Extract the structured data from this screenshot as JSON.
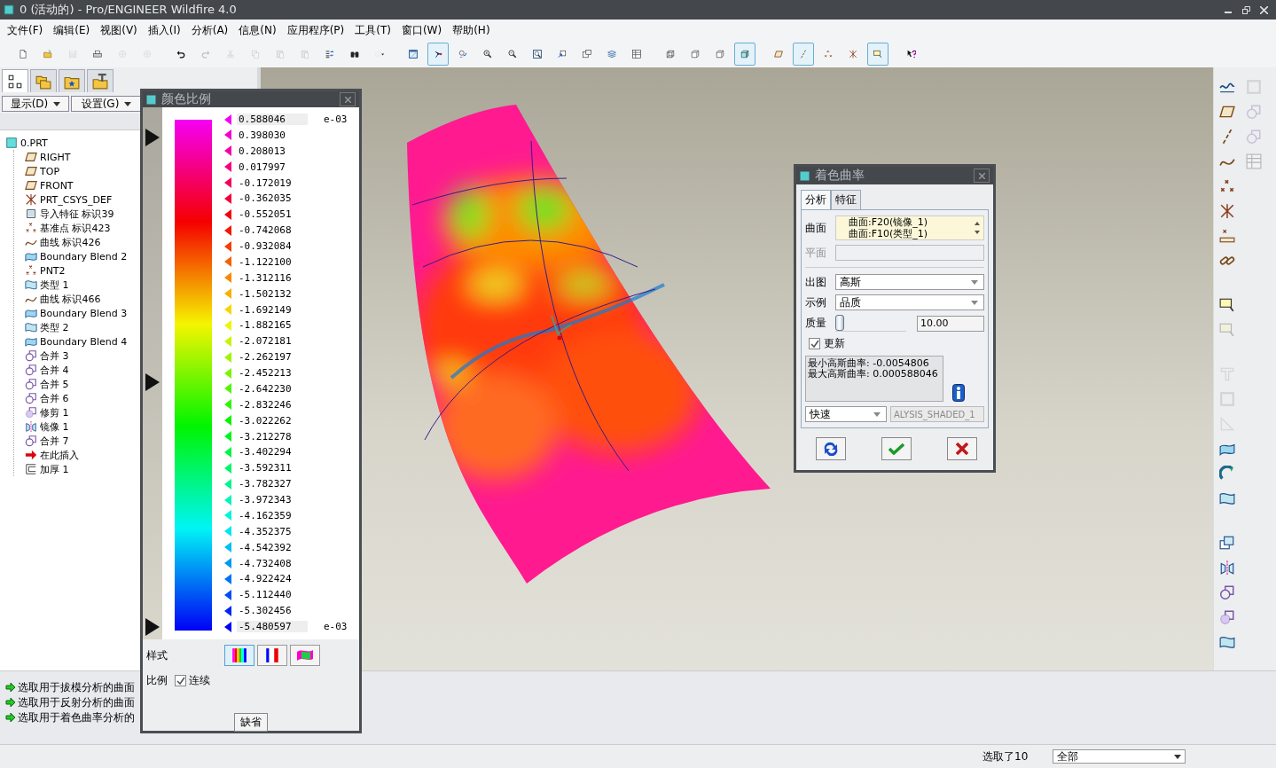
{
  "window": {
    "title": "0 (活动的) - Pro/ENGINEER Wildfire 4.0"
  },
  "menu": [
    "文件(F)",
    "编辑(E)",
    "视图(V)",
    "插入(I)",
    "分析(A)",
    "信息(N)",
    "应用程序(P)",
    "工具(T)",
    "窗口(W)",
    "帮助(H)"
  ],
  "toolbar": [
    [
      {
        "kind": "new",
        "on": false,
        "disabled": false
      },
      {
        "kind": "open",
        "on": false,
        "disabled": false
      },
      {
        "kind": "save",
        "on": false,
        "disabled": true
      },
      {
        "kind": "print",
        "on": false,
        "disabled": false
      },
      {
        "kind": "mail",
        "on": false,
        "disabled": true
      },
      {
        "kind": "mail",
        "on": false,
        "disabled": true
      }
    ],
    [
      {
        "kind": "undo",
        "on": false,
        "disabled": false
      },
      {
        "kind": "redo",
        "on": false,
        "disabled": true
      },
      {
        "kind": "cut",
        "on": false,
        "disabled": true
      },
      {
        "kind": "copy",
        "on": false,
        "disabled": true
      },
      {
        "kind": "paste",
        "on": false,
        "disabled": true
      },
      {
        "kind": "paste",
        "on": false,
        "disabled": true
      },
      {
        "kind": "regen",
        "on": false,
        "disabled": false
      },
      {
        "kind": "find",
        "on": false,
        "disabled": false
      },
      {
        "kind": "selectbox",
        "on": false,
        "disabled": true
      }
    ],
    [
      {
        "kind": "repaint",
        "on": false,
        "disabled": false
      },
      {
        "kind": "spin",
        "on": true,
        "disabled": false
      },
      {
        "kind": "orient",
        "on": false,
        "disabled": false
      },
      {
        "kind": "zoomin",
        "on": false,
        "disabled": false
      },
      {
        "kind": "zoomout",
        "on": false,
        "disabled": false
      },
      {
        "kind": "refit",
        "on": false,
        "disabled": false
      },
      {
        "kind": "reorient",
        "on": false,
        "disabled": false
      },
      {
        "kind": "views",
        "on": false,
        "disabled": false
      },
      {
        "kind": "layers",
        "on": false,
        "disabled": false
      },
      {
        "kind": "table",
        "on": false,
        "disabled": false
      }
    ],
    [
      {
        "kind": "wireframe",
        "on": false,
        "disabled": false
      },
      {
        "kind": "cube",
        "on": false,
        "disabled": false
      },
      {
        "kind": "cube",
        "on": false,
        "disabled": false
      },
      {
        "kind": "shaded",
        "on": true,
        "disabled": false
      }
    ],
    [
      {
        "kind": "plane",
        "on": false,
        "disabled": false
      },
      {
        "kind": "axis",
        "on": true,
        "disabled": false
      },
      {
        "kind": "points",
        "on": false,
        "disabled": false
      },
      {
        "kind": "csys",
        "on": false,
        "disabled": false
      },
      {
        "kind": "note",
        "on": true,
        "disabled": false
      }
    ],
    [
      {
        "kind": "help",
        "on": false,
        "disabled": false
      }
    ]
  ],
  "nav_tabs": [
    {
      "kind": "tree",
      "selected": true
    },
    {
      "kind": "folders",
      "selected": false
    },
    {
      "kind": "starfolder",
      "selected": false
    },
    {
      "kind": "toolfolder",
      "selected": false
    }
  ],
  "nav_buttons": [
    "显示(D)",
    "设置(G)"
  ],
  "tree": {
    "label": "0.PRT",
    "kind": "part",
    "children": [
      {
        "label": "RIGHT",
        "kind": "plane"
      },
      {
        "label": "TOP",
        "kind": "plane"
      },
      {
        "label": "FRONT",
        "kind": "plane"
      },
      {
        "label": "PRT_CSYS_DEF",
        "kind": "csys"
      },
      {
        "label": "导入特征 标识39",
        "kind": "import"
      },
      {
        "label": "基准点 标识423",
        "kind": "points"
      },
      {
        "label": "曲线 标识426",
        "kind": "curve"
      },
      {
        "label": "Boundary Blend 2",
        "kind": "blend"
      },
      {
        "label": "PNT2",
        "kind": "points"
      },
      {
        "label": "类型 1",
        "kind": "surface"
      },
      {
        "label": "曲线 标识466",
        "kind": "curve"
      },
      {
        "label": "Boundary Blend 3",
        "kind": "blend"
      },
      {
        "label": "类型 2",
        "kind": "surface"
      },
      {
        "label": "Boundary Blend 4",
        "kind": "blend"
      },
      {
        "label": "合并 3",
        "kind": "merge"
      },
      {
        "label": "合并 4",
        "kind": "merge"
      },
      {
        "label": "合并 5",
        "kind": "merge"
      },
      {
        "label": "合并 6",
        "kind": "merge"
      },
      {
        "label": "修剪 1",
        "kind": "trim"
      },
      {
        "label": "镜像 1",
        "kind": "mirror"
      },
      {
        "label": "合并 7",
        "kind": "merge"
      },
      {
        "label": "在此插入",
        "kind": "insert"
      },
      {
        "label": "加厚 1",
        "kind": "thicken"
      }
    ]
  },
  "right_toolbar": [
    [
      {
        "kind": "sketch",
        "disabled": false
      },
      {
        "kind": "plane",
        "disabled": false
      },
      {
        "kind": "axis",
        "disabled": false
      },
      {
        "kind": "curve",
        "disabled": false
      },
      {
        "kind": "points",
        "disabled": false
      },
      {
        "kind": "csys",
        "disabled": false
      },
      {
        "kind": "ruler",
        "disabled": false
      },
      {
        "kind": "chain",
        "disabled": false
      }
    ],
    [
      {
        "kind": "note",
        "disabled": false
      },
      {
        "kind": "note",
        "disabled": true
      }
    ],
    [
      {
        "kind": "hole",
        "disabled": true
      },
      {
        "kind": "shell",
        "disabled": true
      },
      {
        "kind": "rib",
        "disabled": true
      },
      {
        "kind": "blend",
        "disabled": false
      },
      {
        "kind": "revolve",
        "disabled": false
      },
      {
        "kind": "surface",
        "disabled": false
      }
    ],
    [
      {
        "kind": "offset",
        "disabled": false
      },
      {
        "kind": "mirror",
        "disabled": false
      },
      {
        "kind": "merge",
        "disabled": false
      },
      {
        "kind": "trim",
        "disabled": false
      },
      {
        "kind": "surface",
        "disabled": false
      }
    ]
  ],
  "right_toolbar_2": [
    {
      "kind": "shell",
      "disabled": true
    },
    {
      "kind": "merge",
      "disabled": true
    },
    {
      "kind": "merge",
      "disabled": true
    },
    {
      "kind": "table",
      "disabled": true
    }
  ],
  "color_scale": {
    "title": "颜色比例",
    "labels": [
      {
        "kind": "field",
        "value": "0.588046",
        "unit": "e-03"
      },
      {
        "kind": "label",
        "value": "0.398030"
      },
      {
        "kind": "label",
        "value": "0.208013"
      },
      {
        "kind": "label",
        "value": "0.017997"
      },
      {
        "kind": "label",
        "value": "-0.172019"
      },
      {
        "kind": "label",
        "value": "-0.362035"
      },
      {
        "kind": "label",
        "value": "-0.552051"
      },
      {
        "kind": "label",
        "value": "-0.742068"
      },
      {
        "kind": "label",
        "value": "-0.932084"
      },
      {
        "kind": "label",
        "value": "-1.122100"
      },
      {
        "kind": "label",
        "value": "-1.312116"
      },
      {
        "kind": "label",
        "value": "-1.502132"
      },
      {
        "kind": "label",
        "value": "-1.692149"
      },
      {
        "kind": "label",
        "value": "-1.882165"
      },
      {
        "kind": "label",
        "value": "-2.072181"
      },
      {
        "kind": "label",
        "value": "-2.262197"
      },
      {
        "kind": "label",
        "value": "-2.452213"
      },
      {
        "kind": "label",
        "value": "-2.642230"
      },
      {
        "kind": "label",
        "value": "-2.832246"
      },
      {
        "kind": "label",
        "value": "-3.022262"
      },
      {
        "kind": "label",
        "value": "-3.212278"
      },
      {
        "kind": "label",
        "value": "-3.402294"
      },
      {
        "kind": "label",
        "value": "-3.592311"
      },
      {
        "kind": "label",
        "value": "-3.782327"
      },
      {
        "kind": "label",
        "value": "-3.972343"
      },
      {
        "kind": "label",
        "value": "-4.162359"
      },
      {
        "kind": "label",
        "value": "-4.352375"
      },
      {
        "kind": "label",
        "value": "-4.542392"
      },
      {
        "kind": "label",
        "value": "-4.732408"
      },
      {
        "kind": "label",
        "value": "-4.922424"
      },
      {
        "kind": "label",
        "value": "-5.112440"
      },
      {
        "kind": "label",
        "value": "-5.302456"
      },
      {
        "kind": "field",
        "value": "-5.480597",
        "unit": "e-03"
      }
    ],
    "style_label": "样式",
    "styles": [
      {
        "kind": "bands",
        "selected": true
      },
      {
        "kind": "stripes",
        "selected": false
      },
      {
        "kind": "surface",
        "selected": false
      }
    ],
    "scale_label": "比例",
    "continuous": {
      "label": "连续",
      "checked": true
    },
    "default_button": "缺省"
  },
  "curvature_dialog": {
    "title": "着色曲率",
    "tabs": [
      {
        "label": "分析",
        "selected": true
      },
      {
        "label": "特征",
        "selected": false
      }
    ],
    "surface_label": "曲面",
    "surfaces": [
      "曲面:F20(镜像_1)",
      "曲面:F10(类型_1)"
    ],
    "plane_label": "平面",
    "plane_disabled": true,
    "output": {
      "label": "出图",
      "value": "高斯"
    },
    "display": {
      "label": "示例",
      "value": "品质"
    },
    "quality": {
      "label": "质量",
      "level": 0,
      "value": "10.00"
    },
    "update": {
      "label": "更新",
      "checked": true
    },
    "results": [
      "最小高斯曲率: -0.0054806",
      "最大高斯曲率: 0.000588046"
    ],
    "mode": "快速",
    "name": "ALYSIS_SHADED_1"
  },
  "messages": [
    "选取用于拔模分析的曲面",
    "选取用于反射分析的曲面",
    "选取用于着色曲率分析的"
  ],
  "status": {
    "selection": "选取了10",
    "filter": "全部"
  }
}
